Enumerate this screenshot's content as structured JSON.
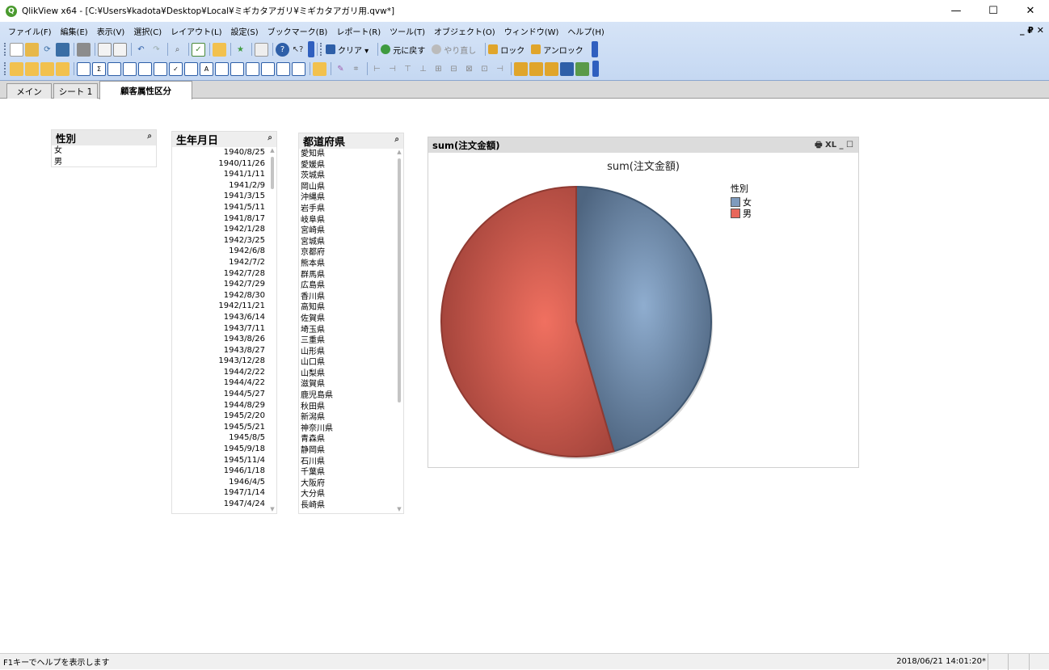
{
  "window": {
    "title": "QlikView x64 - [C:¥Users¥kadota¥Desktop¥Local¥ミギカタアガリ¥ミギカタアガリ用.qvw*]",
    "minimize": "—",
    "maximize": "☐",
    "close": "✕"
  },
  "menu": [
    "ファイル(F)",
    "編集(E)",
    "表示(V)",
    "選択(C)",
    "レイアウト(L)",
    "設定(S)",
    "ブックマーク(B)",
    "レポート(R)",
    "ツール(T)",
    "オブジェクト(O)",
    "ウィンドウ(W)",
    "ヘルプ(H)"
  ],
  "mdi_controls": "_ ₽ ✕",
  "toolbar": {
    "clear": "クリア ▾",
    "back": "元に戻す",
    "forward": "やり直し",
    "lock": "ロック",
    "unlock": "アンロック"
  },
  "tabs": [
    "メイン",
    "シート 1",
    "顧客属性区分"
  ],
  "active_tab": "顧客属性区分",
  "listbox_gender": {
    "caption": "性別",
    "items": [
      "女",
      "男"
    ]
  },
  "listbox_birthdate": {
    "caption": "生年月日",
    "items": [
      "1940/8/25",
      "1940/11/26",
      "1941/1/11",
      "1941/2/9",
      "1941/3/15",
      "1941/5/11",
      "1941/8/17",
      "1942/1/28",
      "1942/3/25",
      "1942/6/8",
      "1942/7/2",
      "1942/7/28",
      "1942/7/29",
      "1942/8/30",
      "1942/11/21",
      "1943/6/14",
      "1943/7/11",
      "1943/8/26",
      "1943/8/27",
      "1943/12/28",
      "1944/2/22",
      "1944/4/22",
      "1944/5/27",
      "1944/8/29",
      "1945/2/20",
      "1945/5/21",
      "1945/8/5",
      "1945/9/18",
      "1945/11/4",
      "1946/1/18",
      "1946/4/5",
      "1947/1/14",
      "1947/4/24"
    ]
  },
  "listbox_prefecture": {
    "caption": "都道府県",
    "items": [
      "愛知県",
      "愛媛県",
      "茨城県",
      "岡山県",
      "沖縄県",
      "岩手県",
      "岐阜県",
      "宮崎県",
      "宮城県",
      "京都府",
      "熊本県",
      "群馬県",
      "広島県",
      "香川県",
      "高知県",
      "佐賀県",
      "埼玉県",
      "三重県",
      "山形県",
      "山口県",
      "山梨県",
      "滋賀県",
      "鹿児島県",
      "秋田県",
      "新潟県",
      "神奈川県",
      "青森県",
      "静岡県",
      "石川県",
      "千葉県",
      "大阪府",
      "大分県",
      "長崎県"
    ]
  },
  "chart_object": {
    "caption": "sum(注文金額)",
    "controls": "🖶 XL _ ☐"
  },
  "chart_data": {
    "type": "pie",
    "title": "sum(注文金額)",
    "legend_title": "性別",
    "legend_position": "top-right",
    "categories": [
      "女",
      "男"
    ],
    "values": [
      45.5,
      54.5
    ],
    "colors": [
      "#7f9bbd",
      "#e8675a"
    ]
  },
  "status": {
    "help": "F1キーでヘルプを表示します",
    "timestamp": "2018/06/21 14:01:20*"
  }
}
